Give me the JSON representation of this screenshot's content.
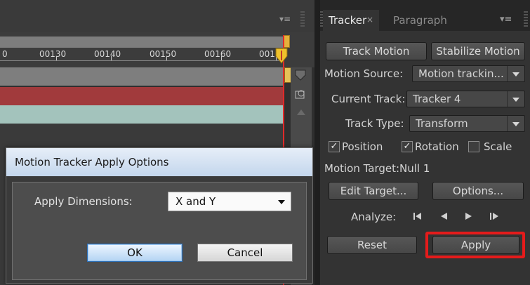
{
  "timeline": {
    "ticks": [
      "0",
      "00130",
      "00140",
      "00150",
      "00160",
      "001"
    ],
    "panel_menu_icon": "panel-menu-icon"
  },
  "dialog": {
    "title": "Motion Tracker Apply Options",
    "dimensions_label": "Apply Dimensions:",
    "dimensions_value": "X and Y",
    "ok_label": "OK",
    "cancel_label": "Cancel"
  },
  "tracker": {
    "tabs": [
      "Tracker",
      "Paragraph"
    ],
    "tab_close": "×",
    "panel_menu": "▾≡",
    "track_motion": "Track Motion",
    "stabilize_motion": "Stabilize Motion",
    "motion_source_label": "Motion Source:",
    "motion_source_value": "Motion trackin...",
    "current_track_label": "Current Track:",
    "current_track_value": "Tracker 4",
    "track_type_label": "Track Type:",
    "track_type_value": "Transform",
    "position_label": "Position",
    "rotation_label": "Rotation",
    "scale_label": "Scale",
    "position_checked": true,
    "rotation_checked": true,
    "scale_checked": false,
    "motion_target_label": "Motion Target:",
    "motion_target_value": "Null 1",
    "edit_target": "Edit Target...",
    "options": "Options...",
    "analyze_label": "Analyze:",
    "reset": "Reset",
    "apply": "Apply"
  },
  "colors": {
    "highlight": "#e51b1b",
    "playhead": "#e02a2a",
    "layer_red": "#a13a3c",
    "layer_teal": "#a3c3bc"
  }
}
